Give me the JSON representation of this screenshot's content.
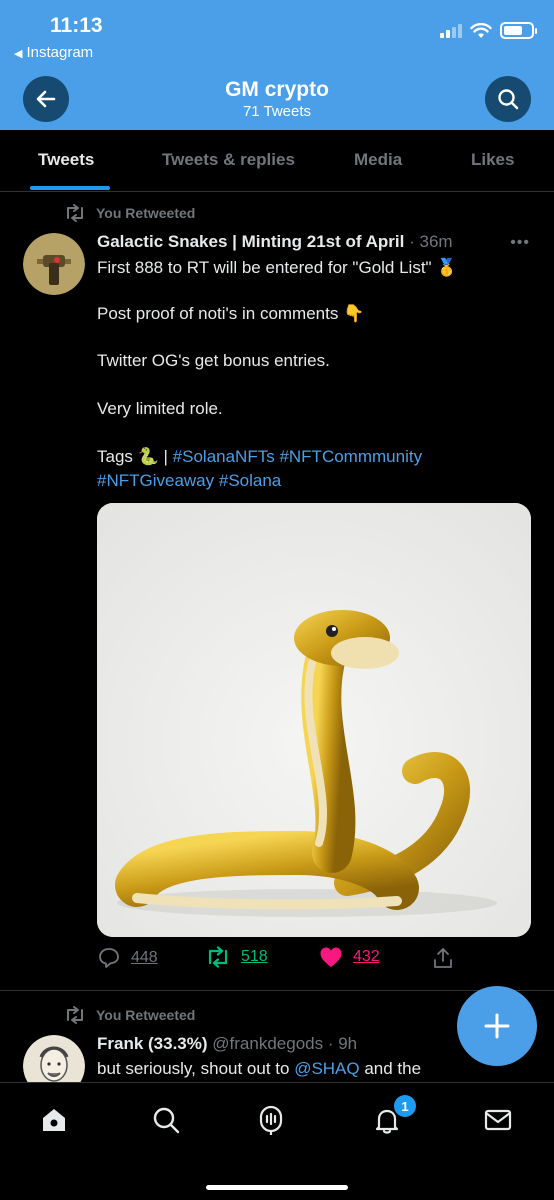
{
  "status_bar": {
    "time": "11:13",
    "back_app": "Instagram"
  },
  "header": {
    "title": "GM crypto",
    "subtitle": "71 Tweets"
  },
  "tabs": [
    {
      "label": "Tweets",
      "active": true
    },
    {
      "label": "Tweets & replies",
      "active": false
    },
    {
      "label": "Media",
      "active": false
    },
    {
      "label": "Likes",
      "active": false
    }
  ],
  "tweets": [
    {
      "retweet_label": "You Retweeted",
      "name": "Galactic Snakes | Minting 21st of April",
      "meta": "· 36m",
      "lines": {
        "l1": "First 888 to RT will be entered for \"Gold List\" 🥇",
        "l2": "Post proof of noti's in comments 👇",
        "l3": "Twitter OG's get bonus entries.",
        "l4": "Very limited role.",
        "l5_prefix": "Tags 🐍 | ",
        "l5_tags": "#SolanaNFTs #NFTCommmunity",
        "l6_tags": "#NFTGiveaway #Solana"
      },
      "stats": {
        "replies": "448",
        "retweets": "518",
        "likes": "432"
      }
    },
    {
      "retweet_label": "You Retweeted",
      "name": "Frank (33.3%)",
      "meta": "@frankdegods · 9h",
      "text_prefix": "but seriously, shout out to ",
      "mention": "@SHAQ",
      "text_suffix": " and the"
    }
  ],
  "nav": {
    "notifications_badge": "1"
  },
  "colors": {
    "accent": "#4a9fe8",
    "retweet": "#00ba7c",
    "like": "#f91880",
    "muted": "#71767b"
  }
}
